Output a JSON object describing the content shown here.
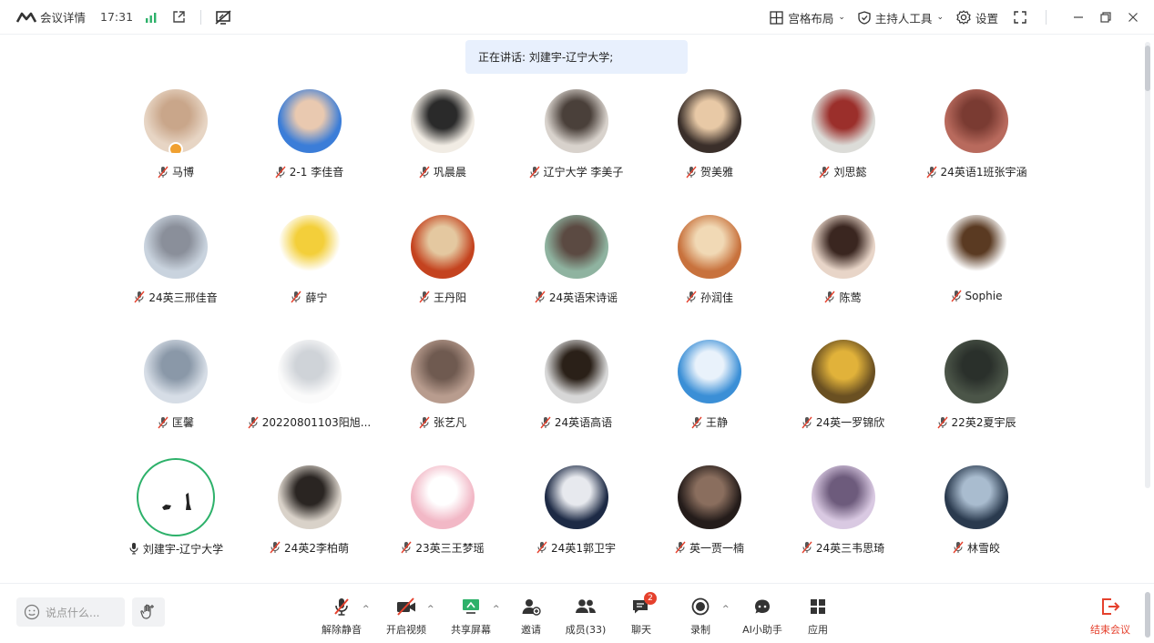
{
  "topbar": {
    "title": "会议详情",
    "time": "17:31",
    "layout_label": "宫格布局",
    "host_tools_label": "主持人工具",
    "settings_label": "设置"
  },
  "speaking": {
    "text": "正在讲话: 刘建宇-辽宁大学;"
  },
  "participants": [
    {
      "name": "马博",
      "colors": [
        "#e7d5c4",
        "#c9a68a"
      ],
      "muted": true,
      "badge": true
    },
    {
      "name": "2-1 李佳音",
      "colors": [
        "#3b7dd8",
        "#e9c9b0"
      ],
      "muted": true
    },
    {
      "name": "巩晨晨",
      "colors": [
        "#f1ece4",
        "#2a2a2a"
      ],
      "muted": true
    },
    {
      "name": "辽宁大学 李美子",
      "colors": [
        "#d8d2cc",
        "#4a403a"
      ],
      "muted": true
    },
    {
      "name": "贺美雅",
      "colors": [
        "#3a2f2a",
        "#e8c9a6"
      ],
      "muted": true
    },
    {
      "name": "刘思懿",
      "colors": [
        "#dcdcd8",
        "#9b2f2b"
      ],
      "muted": true
    },
    {
      "name": "24英语1班张宇涵",
      "colors": [
        "#b86a5d",
        "#7a3b32"
      ],
      "muted": true
    },
    {
      "name": "24英三邢佳音",
      "colors": [
        "#c9d3de",
        "#8a8f9a"
      ],
      "muted": true
    },
    {
      "name": "薛宁",
      "colors": [
        "#ffffff",
        "#f3cf3a"
      ],
      "muted": true
    },
    {
      "name": "王丹阳",
      "colors": [
        "#c4431f",
        "#e4c8a0"
      ],
      "muted": true
    },
    {
      "name": "24英语宋诗谣",
      "colors": [
        "#8fb3a0",
        "#5b4a42"
      ],
      "muted": true
    },
    {
      "name": "孙润佳",
      "colors": [
        "#c8723d",
        "#f1d9b5"
      ],
      "muted": true
    },
    {
      "name": "陈莺",
      "colors": [
        "#e8d5c8",
        "#3a2620"
      ],
      "muted": true
    },
    {
      "name": "Sophie",
      "colors": [
        "#ffffff",
        "#5a3a22"
      ],
      "muted": true
    },
    {
      "name": "匡馨",
      "colors": [
        "#d6dde6",
        "#8a98a8"
      ],
      "muted": true
    },
    {
      "name": "20220801103阳旭...",
      "colors": [
        "#fbfbfb",
        "#cfd3d8"
      ],
      "muted": true
    },
    {
      "name": "张艺凡",
      "colors": [
        "#b89c8e",
        "#6f5a50"
      ],
      "muted": true
    },
    {
      "name": "24英语高语",
      "colors": [
        "#d7d7d7",
        "#2a2018"
      ],
      "muted": true
    },
    {
      "name": "王静",
      "colors": [
        "#3b8fd6",
        "#e9f2fb"
      ],
      "muted": true
    },
    {
      "name": "24英一罗锦欣",
      "colors": [
        "#6a5022",
        "#e1b23a"
      ],
      "muted": true
    },
    {
      "name": "22英2夏宇辰",
      "colors": [
        "#4b5548",
        "#2a302b"
      ],
      "muted": true
    },
    {
      "name": "刘建宇-辽宁大学",
      "colors": [
        "#ffffff",
        "#222222"
      ],
      "muted": false,
      "speaker": true
    },
    {
      "name": "24英2李柏萌",
      "colors": [
        "#d9d2c9",
        "#2a2522"
      ],
      "muted": true
    },
    {
      "name": "23英三王梦瑶",
      "colors": [
        "#f2b8c6",
        "#ffffff"
      ],
      "muted": true
    },
    {
      "name": "24英1郭卫宇",
      "colors": [
        "#1d2a45",
        "#e7e9ee"
      ],
      "muted": true
    },
    {
      "name": "英一贾一楠",
      "colors": [
        "#241c1a",
        "#8a6e5e"
      ],
      "muted": true
    },
    {
      "name": "24英三韦思琦",
      "colors": [
        "#d9c9e2",
        "#6d5b7c"
      ],
      "muted": true
    },
    {
      "name": "林雪皎",
      "colors": [
        "#2a3a4e",
        "#a9bccf"
      ],
      "muted": true
    }
  ],
  "bottombar": {
    "chat_placeholder": "说点什么...",
    "tools": [
      {
        "label": "解除静音"
      },
      {
        "label": "开启视频"
      },
      {
        "label": "共享屏幕"
      },
      {
        "label": "邀请"
      },
      {
        "label": "成员(33)"
      },
      {
        "label": "聊天"
      },
      {
        "label": "录制"
      },
      {
        "label": "AI小助手"
      },
      {
        "label": "应用"
      }
    ],
    "chat_badge": "2",
    "end_label": "结束会议"
  },
  "colors": {
    "accent": "#2db16a",
    "danger": "#e5412d",
    "speaking_bg": "#e8f0fd"
  }
}
